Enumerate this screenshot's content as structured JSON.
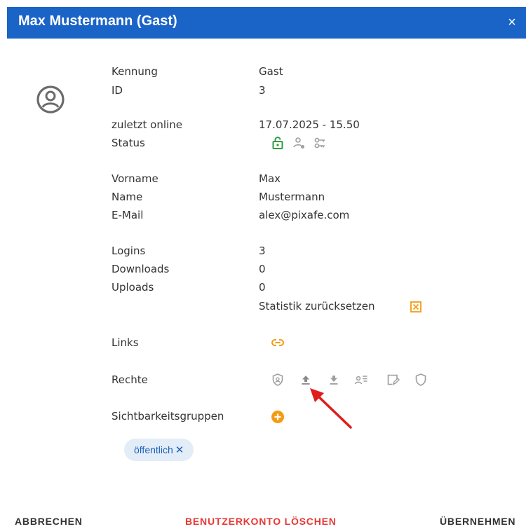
{
  "dialog": {
    "title": "Max Mustermann (Gast)",
    "close_glyph": "×"
  },
  "fields": {
    "kennung": {
      "label": "Kennung",
      "value": "Gast"
    },
    "id": {
      "label": "ID",
      "value": "3"
    },
    "zuletzt_online": {
      "label": "zuletzt online",
      "value": "17.07.2025 - 15.50"
    },
    "status": {
      "label": "Status"
    },
    "vorname": {
      "label": "Vorname",
      "value": "Max"
    },
    "name": {
      "label": "Name",
      "value": "Mustermann"
    },
    "email": {
      "label": "E-Mail",
      "value": "alex@pixafe.com"
    },
    "logins": {
      "label": "Logins",
      "value": "3"
    },
    "downloads": {
      "label": "Downloads",
      "value": "0"
    },
    "uploads": {
      "label": "Uploads",
      "value": "0"
    },
    "reset_stats": {
      "label": "Statistik zurücksetzen"
    },
    "links": {
      "label": "Links"
    },
    "rechte": {
      "label": "Rechte"
    },
    "sichtbarkeitsgruppen": {
      "label": "Sichtbarkeitsgruppen"
    }
  },
  "status_icons": [
    "lock-open-icon",
    "person-icon",
    "key-icon"
  ],
  "rights_icons": [
    "shield-admin-icon",
    "upload-icon",
    "download-icon",
    "user-list-icon",
    "edit-note-icon",
    "shield-outline-icon"
  ],
  "groups": [
    {
      "label": "öffentlich",
      "remove_glyph": "✕"
    }
  ],
  "footer": {
    "cancel": "ABBRECHEN",
    "delete": "BENUTZERKONTO LÖSCHEN",
    "apply": "ÜBERNEHMEN"
  },
  "colors": {
    "header": "#1a63c7",
    "status_ok": "#2e9e3f",
    "accent_orange": "#f39c12",
    "delete_red": "#e53935",
    "icon_gray": "#9e9e9e",
    "arrow_red": "#e01c1c"
  }
}
